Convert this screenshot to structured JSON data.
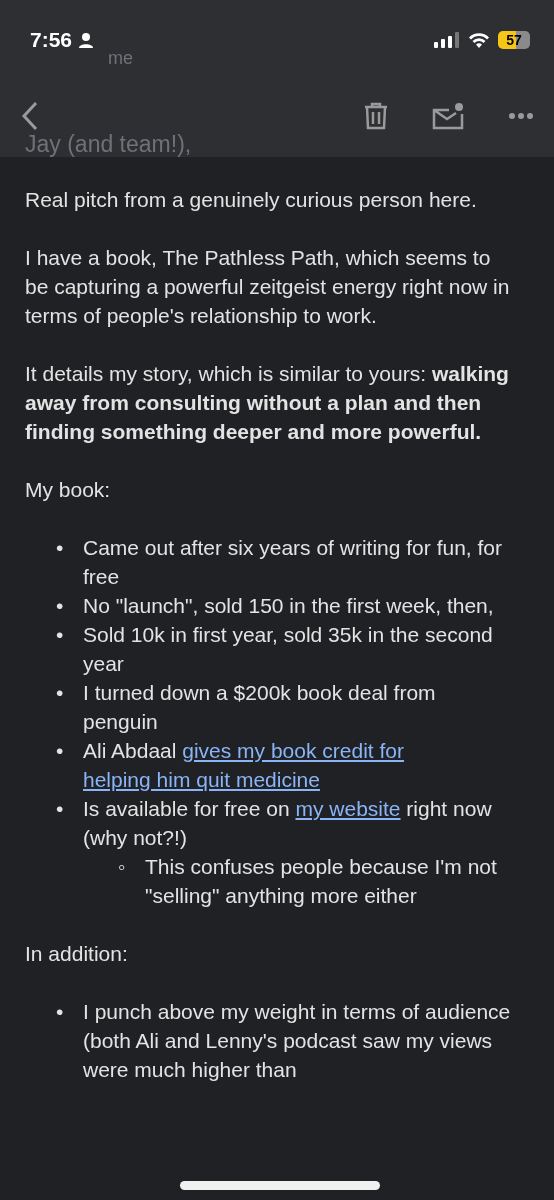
{
  "status_bar": {
    "time": "7:56",
    "battery": "57"
  },
  "faded_header": {
    "sender": "me",
    "greeting": "Jay (and team!),"
  },
  "body": [
    {
      "kind": "paragraph",
      "text": "Real pitch from a genuinely curious person here."
    },
    {
      "kind": "paragraph",
      "text": "I have a book, The Pathless Path, which seems to be capturing a powerful zeitgeist energy right now in terms of people's relationship to work."
    },
    {
      "kind": "paragraph",
      "text": "It details my story, which is similar to yours: **walking away from consulting without a plan and then finding something deeper and more powerful.**"
    },
    {
      "kind": "paragraph",
      "text": "My book:"
    },
    {
      "kind": "list",
      "items": [
        {
          "bullet": "•",
          "parts": [
            {
              "kind": "text",
              "text": "Came out after six years of writing for fun, for free"
            }
          ]
        },
        {
          "bullet": "•",
          "parts": [
            {
              "kind": "text",
              "text": "No \"launch\", sold 150 in the first week, then,"
            }
          ]
        },
        {
          "bullet": "•",
          "parts": [
            {
              "kind": "text",
              "text": "Sold 10k in first year, sold 35k in the second year"
            }
          ]
        },
        {
          "bullet": "•",
          "parts": [
            {
              "kind": "text",
              "text": "I turned down a $200k book deal from penguin"
            }
          ]
        },
        {
          "bullet": "•",
          "parts": [
            {
              "kind": "text",
              "text": "Ali Abdaal"
            },
            {
              "kind": "link",
              "text": "gives my book credit for"
            },
            {
              "kind": "link",
              "text": "helping him quit medicine"
            }
          ]
        },
        {
          "bullet": "•",
          "parts": [
            {
              "kind": "text",
              "text": "Is available for free on"
            },
            {
              "kind": "link",
              "text": "my website"
            },
            {
              "kind": "text",
              "text": "right now (why not?!)"
            }
          ],
          "children": [
            {
              "bullet": "◦",
              "parts": [
                {
                  "kind": "text",
                  "text": "This confuses people because I'm not \"selling\" anything more either"
                }
              ]
            }
          ]
        }
      ]
    },
    {
      "kind": "paragraph",
      "text": "In addition:"
    },
    {
      "kind": "list",
      "items": [
        {
          "bullet": "•",
          "parts": [
            {
              "kind": "text",
              "text": "I punch above my weight in terms of audience (both Ali and Lenny's podcast saw my views were much higher than"
            }
          ]
        }
      ]
    }
  ]
}
